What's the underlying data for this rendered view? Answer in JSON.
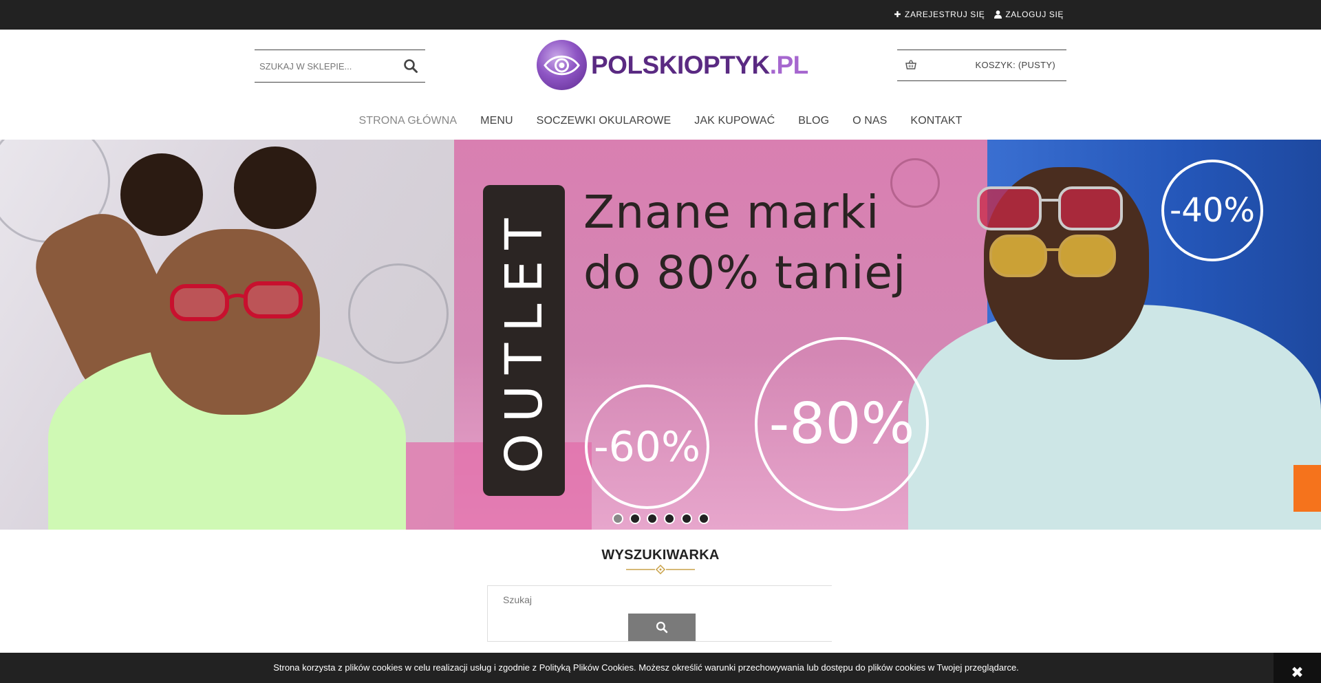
{
  "topbar": {
    "register_label": "ZAREJESTRUJ SIĘ",
    "login_label": "ZALOGUJ SIĘ"
  },
  "header": {
    "search_placeholder": "SZUKAJ W SKLEPIE...",
    "logo_main": "POLSKIOPTYK",
    "logo_tld": ".PL",
    "cart_label": "KOSZYK: (PUSTY)"
  },
  "nav": {
    "items": [
      {
        "label": "STRONA GŁÓWNA"
      },
      {
        "label": "MENU"
      },
      {
        "label": "SOCZEWKI OKULAROWE"
      },
      {
        "label": "JAK KUPOWAĆ"
      },
      {
        "label": "BLOG"
      },
      {
        "label": "O NAS"
      },
      {
        "label": "KONTAKT"
      }
    ],
    "active_index": 0
  },
  "hero": {
    "outlet_label": "OUTLET",
    "headline_line1": "Znane marki",
    "headline_line2": "do 80% taniej",
    "badge_60": "-60%",
    "badge_80": "-80%",
    "badge_40": "-40%",
    "slide_count": 6,
    "active_slide": 1
  },
  "search_section": {
    "title": "WYSZUKIWARKA",
    "placeholder": "Szukaj"
  },
  "cookie": {
    "text": "Strona korzysta z plików cookies w celu realizacji usług i zgodnie z Polityką Plików Cookies. Możesz określić warunki przechowywania lub dostępu do plików cookies w Twojej przeglądarce.",
    "close_symbol": "✖"
  },
  "colors": {
    "topbar": "#222222",
    "brand_purple": "#5a2a82",
    "accent_orange": "#f5731c",
    "hero_pink": "#d97fb1",
    "hero_blue": "#2456b8"
  },
  "icons": [
    "plus-icon",
    "user-icon",
    "search-icon",
    "basket-icon",
    "close-icon",
    "ornament-divider"
  ]
}
